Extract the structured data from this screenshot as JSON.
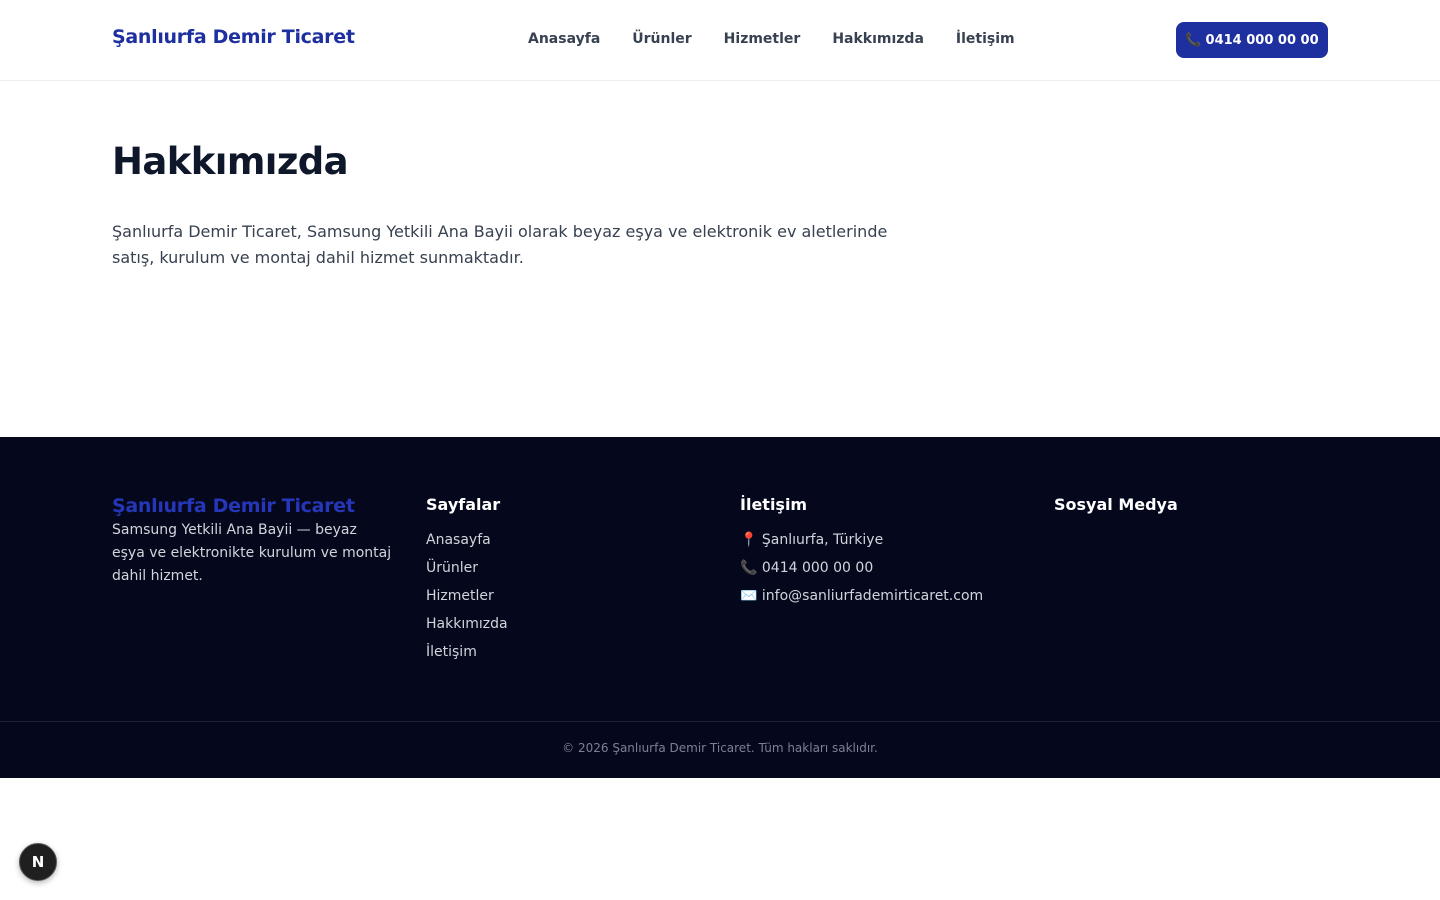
{
  "header": {
    "brand": "Şanlıurfa Demir Ticaret",
    "nav": [
      "Anasayfa",
      "Ürünler",
      "Hizmetler",
      "Hakkımızda",
      "İletişim"
    ],
    "call_icon": "📞",
    "call_label": "0414 000 00 00"
  },
  "main": {
    "title": "Hakkımızda",
    "body": "Şanlıurfa Demir Ticaret, Samsung Yetkili Ana Bayii olarak beyaz eşya ve elektronik ev aletlerinde satış, kurulum ve montaj dahil hizmet sunmaktadır."
  },
  "footer": {
    "brand": "Şanlıurfa Demir Ticaret",
    "description": "Samsung Yetkili Ana Bayii — beyaz eşya ve elektronikte kurulum ve montaj dahil hizmet.",
    "pages_heading": "Sayfalar",
    "pages": [
      "Anasayfa",
      "Ürünler",
      "Hizmetler",
      "Hakkımızda",
      "İletişim"
    ],
    "contact_heading": "İletişim",
    "contact": [
      {
        "icon": "📍",
        "text": "Şanlıurfa, Türkiye"
      },
      {
        "icon": "📞",
        "text": "0414 000 00 00"
      },
      {
        "icon": "✉️",
        "text": "info@sanliurfademirticaret.com"
      }
    ],
    "social_heading": "Sosyal Medya",
    "copyright": "© 2026 Şanlıurfa Demir Ticaret. Tüm hakları saklıdır."
  },
  "badge": {
    "letter": "N"
  },
  "colors": {
    "brand": "#1e2fa0",
    "footer_bg": "#05081c"
  }
}
